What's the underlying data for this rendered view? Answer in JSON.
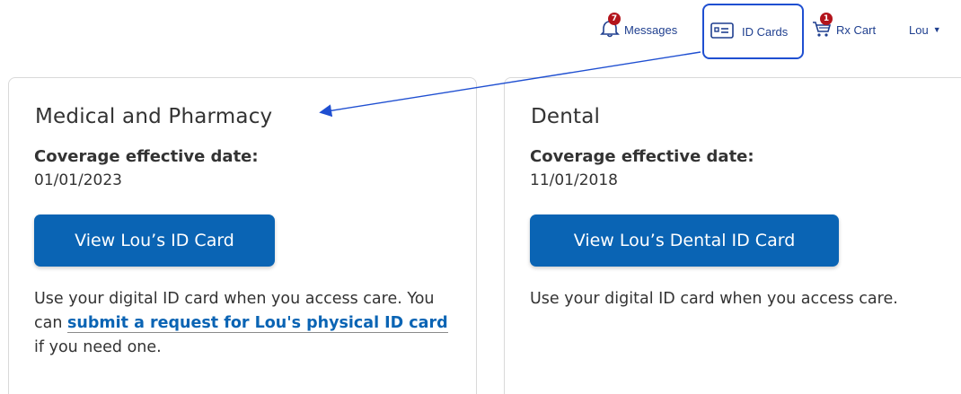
{
  "nav": {
    "messages": {
      "label": "Messages",
      "badge": "7",
      "icon": "bell-icon"
    },
    "id_cards": {
      "label": "ID Cards",
      "icon": "id-card-icon"
    },
    "rx_cart": {
      "label": "Rx Cart",
      "badge": "1",
      "icon": "cart-icon"
    },
    "user": {
      "label": "Lou",
      "icon": "chevron-down-icon"
    }
  },
  "cards": {
    "medical": {
      "title": "Medical and Pharmacy",
      "coverage_label": "Coverage effective date:",
      "coverage_date": "01/01/2023",
      "button_label": "View Lou’s ID Card",
      "help_prefix": "Use your digital ID card when you access care. You can ",
      "help_link": "submit a request for Lou's physical ID card",
      "help_suffix": " if you need one."
    },
    "dental": {
      "title": "Dental",
      "coverage_label": "Coverage effective date:",
      "coverage_date": "11/01/2018",
      "button_label": "View Lou’s Dental ID Card",
      "help_text": "Use your digital ID card when you access care."
    }
  },
  "colors": {
    "primary_button": "#0a64b4",
    "nav_text": "#1f3f8f",
    "badge": "#b3141c",
    "highlight_border": "#1f4fd1"
  }
}
